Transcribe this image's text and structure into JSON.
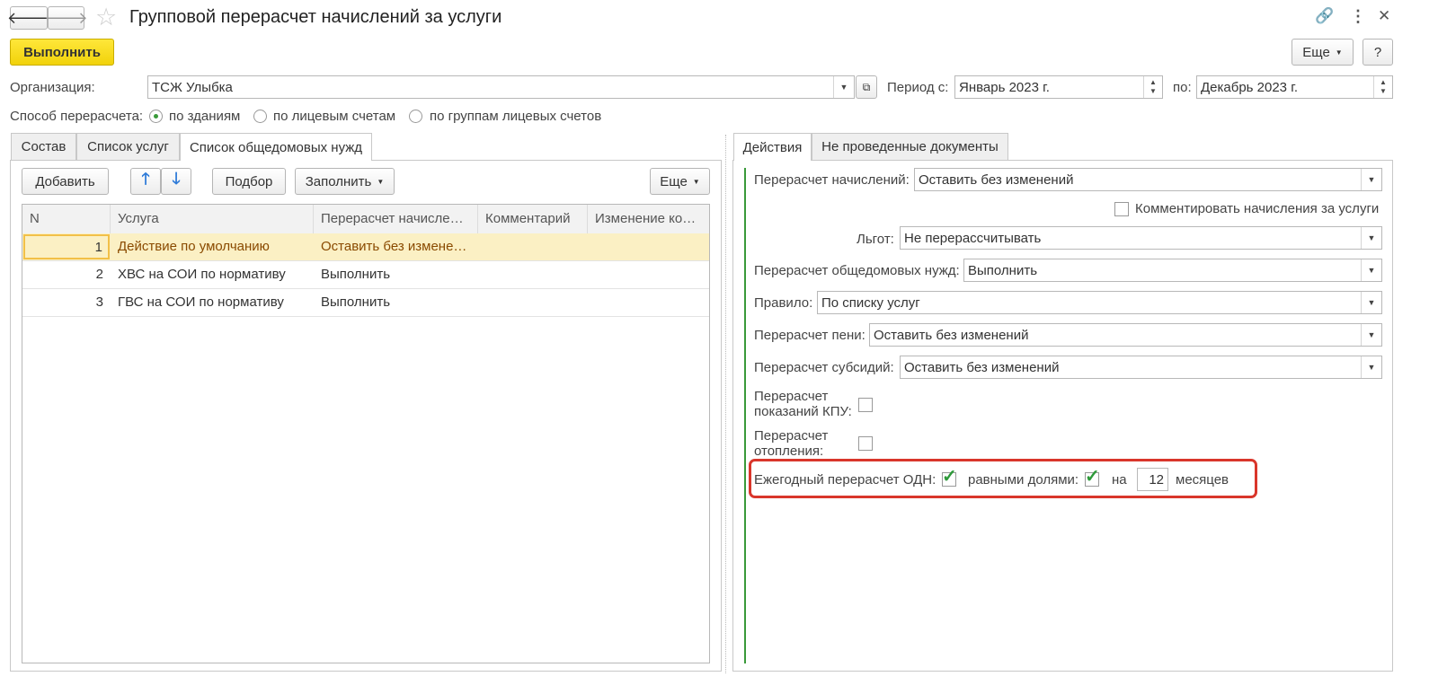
{
  "window": {
    "title": "Групповой перерасчет начислений за услуги"
  },
  "toolbar": {
    "execute_label": "Выполнить",
    "more_label": "Еще",
    "help_label": "?"
  },
  "org": {
    "label": "Организация:",
    "value": "ТСЖ Улыбка"
  },
  "period": {
    "from_label": "Период с:",
    "from_value": "Январь 2023 г.",
    "to_label": "по:",
    "to_value": "Декабрь 2023 г."
  },
  "method": {
    "label": "Способ перерасчета:",
    "options": [
      "по зданиям",
      "по лицевым счетам",
      "по группам лицевых счетов"
    ],
    "selected": 0
  },
  "left_tabs": [
    "Состав",
    "Список услуг",
    "Список общедомовых нужд"
  ],
  "left_toolbar": {
    "add": "Добавить",
    "pick": "Подбор",
    "fill": "Заполнить",
    "more": "Еще"
  },
  "grid": {
    "columns": [
      "N",
      "Услуга",
      "Перерасчет начисле…",
      "Комментарий",
      "Изменение ко…"
    ],
    "rows": [
      {
        "n": "1",
        "service": "Действие по умолчанию",
        "recalc": "Оставить без измене…"
      },
      {
        "n": "2",
        "service": "ХВС на СОИ по нормативу",
        "recalc": "Выполнить"
      },
      {
        "n": "3",
        "service": "ГВС на СОИ по нормативу",
        "recalc": "Выполнить"
      }
    ]
  },
  "right_tabs": [
    "Действия",
    "Не проведенные документы"
  ],
  "actions": {
    "charges_label": "Перерасчет начислений:",
    "charges_value": "Оставить без изменений",
    "comment_label": "Комментировать начисления за услуги",
    "benefits_label": "Льгот:",
    "benefits_value": "Не перерассчитывать",
    "common_label": "Перерасчет общедомовых нужд:",
    "common_value": "Выполнить",
    "rule_label": "Правило:",
    "rule_value": "По списку услуг",
    "penalty_label": "Перерасчет пени:",
    "penalty_value": "Оставить без изменений",
    "subsidy_label": "Перерасчет субсидий:",
    "subsidy_value": "Оставить без изменений",
    "kpu_label_1": "Перерасчет",
    "kpu_label_2": "показаний КПУ:",
    "heating_label_1": "Перерасчет",
    "heating_label_2": "отопления:",
    "odn_label": "Ежегодный перерасчет ОДН:",
    "equal_label": "равными долями:",
    "on_label": "на",
    "months_value": "12",
    "months_label": "месяцев"
  },
  "colors": {
    "accent_yellow": "#f5d90f",
    "highlight": "#d9362b",
    "check": "#2e9a3a",
    "selected_row": "#fbf0c4"
  }
}
